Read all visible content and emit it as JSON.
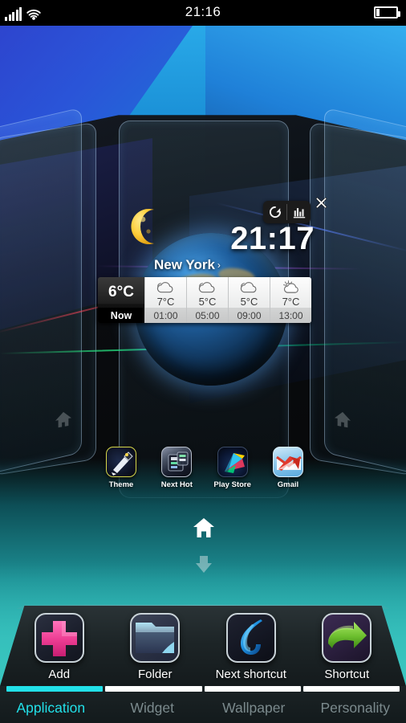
{
  "status_bar": {
    "time": "21:16",
    "signal_icon": "signal-bars-icon",
    "wifi_icon": "wifi-icon",
    "battery_icon": "battery-icon"
  },
  "widget_controls": {
    "refresh_icon": "refresh-icon",
    "chart_icon": "bar-chart-icon",
    "close_icon": "close-x-icon"
  },
  "weather_widget": {
    "clock_time": "21:17",
    "city": "New York",
    "city_arrow": "›",
    "moon_icon": "crescent-moon-icon",
    "earth_icon": "earth-globe-icon",
    "now": {
      "temperature": "6°C",
      "label": "Now"
    },
    "forecast": [
      {
        "icon": "cloudy-icon",
        "temperature": "7°C",
        "time": "01:00"
      },
      {
        "icon": "cloudy-icon",
        "temperature": "5°C",
        "time": "05:00"
      },
      {
        "icon": "cloudy-icon",
        "temperature": "5°C",
        "time": "09:00"
      },
      {
        "icon": "partly-sunny-icon",
        "temperature": "7°C",
        "time": "13:00"
      }
    ]
  },
  "app_row": [
    {
      "label": "Theme",
      "icon": "theme-app-icon"
    },
    {
      "label": "Next Hot",
      "icon": "next-hot-app-icon"
    },
    {
      "label": "Play Store",
      "icon": "play-store-app-icon"
    },
    {
      "label": "Gmail",
      "icon": "gmail-app-icon"
    }
  ],
  "home_button": {
    "icon": "home-icon"
  },
  "scroll_hint": {
    "icon": "chevron-down-icon"
  },
  "dock": [
    {
      "label": "Add",
      "icon": "plus-icon"
    },
    {
      "label": "Folder",
      "icon": "folder-icon"
    },
    {
      "label": "Next shortcut",
      "icon": "next-swirl-icon"
    },
    {
      "label": "Shortcut",
      "icon": "arrow-right-icon"
    }
  ],
  "tabs": [
    {
      "label": "Application",
      "active": true
    },
    {
      "label": "Widget",
      "active": false
    },
    {
      "label": "Wallpaper",
      "active": false
    },
    {
      "label": "Personality",
      "active": false
    }
  ],
  "colors": {
    "accent_cyan": "#22e0e8",
    "tab_idle": "#7b8a8d",
    "add_pink": "#ec3f91",
    "shortcut_green": "#7ac943",
    "next_blue": "#1ea2e8",
    "indicator_white": "#ffffff"
  }
}
